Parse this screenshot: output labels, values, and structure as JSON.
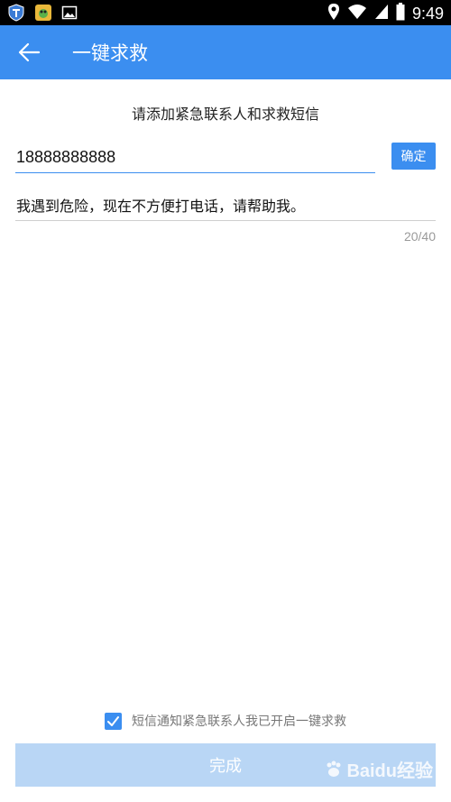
{
  "status_bar": {
    "time": "9:49",
    "left_icons": [
      "shield-app-icon",
      "game-app-icon",
      "gallery-icon"
    ],
    "right_icons": [
      "location-pin-icon",
      "wifi-icon",
      "signal-icon",
      "battery-icon"
    ]
  },
  "app_bar": {
    "back_icon": "arrow-left-icon",
    "title": "一键求救"
  },
  "main": {
    "subtitle": "请添加紧急联系人和求救短信",
    "phone_value": "18888888888",
    "confirm_label": "确定",
    "message_value": "我遇到危险，现在不方便打电话，请帮助我。",
    "char_count": "20/40"
  },
  "footer": {
    "notify_checked": true,
    "notify_label": "短信通知紧急联系人我已开启一键求救",
    "done_label": "完成",
    "watermark": "Baidu经验"
  },
  "colors": {
    "primary": "#3b8ef0",
    "disabled_button": "#b9d6f5",
    "status_bar": "#000000"
  }
}
